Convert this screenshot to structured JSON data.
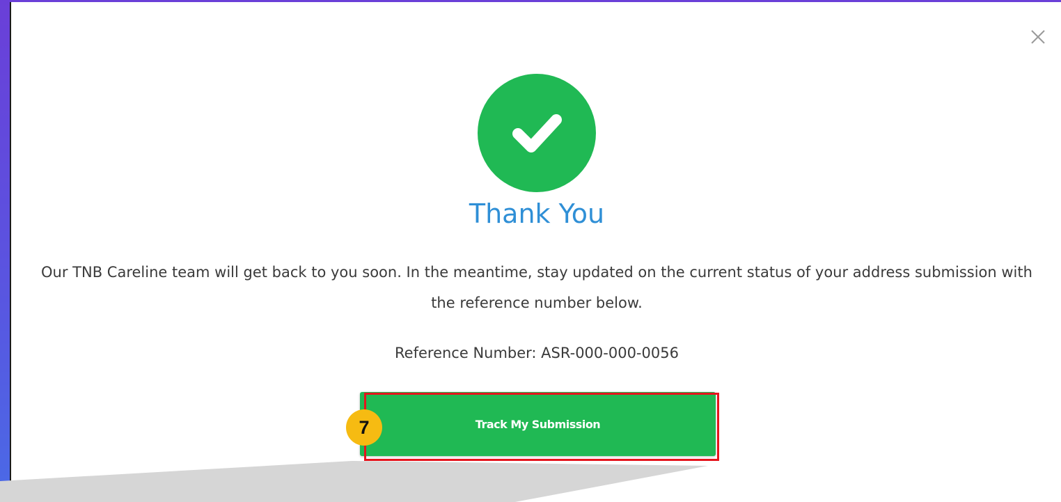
{
  "modal": {
    "title": "Thank You",
    "message": "Our TNB Careline team will get back to you soon. In the meantime, stay updated on the current status of your address submission with the reference number below.",
    "reference": "Reference Number: ASR-000-000-0056",
    "track_button_label": "Track My Submission"
  },
  "annotation": {
    "step_number": "7"
  },
  "colors": {
    "success_green": "#20b954",
    "title_blue": "#2f8fd6",
    "badge_yellow": "#f6bb12",
    "highlight_red": "#e5141d"
  },
  "icons": {
    "close": "close-icon",
    "success": "checkmark-icon"
  }
}
